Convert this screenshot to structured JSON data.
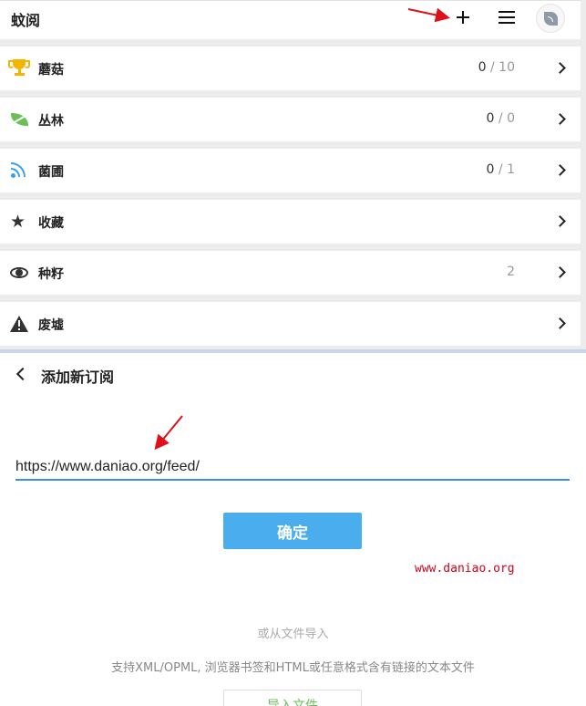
{
  "app": {
    "title": "蚊阅"
  },
  "header_icons": {
    "add": "plus-icon",
    "menu": "menu-icon",
    "avatar": "rss-leaf-icon"
  },
  "menu": [
    {
      "id": "mushroom",
      "label": "蘑菇",
      "icon": "trophy-icon",
      "icon_color": "#f5b400",
      "count": "0",
      "total": "/ 10"
    },
    {
      "id": "jungle",
      "label": "丛林",
      "icon": "leaf-icon",
      "icon_color": "#6bbf59",
      "count": "0",
      "total": "/ 0"
    },
    {
      "id": "nursery",
      "label": "菌圃",
      "icon": "rss-icon",
      "icon_color": "#3aa0e8",
      "count": "0",
      "total": "/ 1"
    },
    {
      "id": "favorites",
      "label": "收藏",
      "icon": "star-icon",
      "icon_color": "#333333",
      "count": "",
      "total": ""
    },
    {
      "id": "seeds",
      "label": "种籽",
      "icon": "eye-icon",
      "icon_color": "#333333",
      "count": "2",
      "total": ""
    },
    {
      "id": "ruins",
      "label": "废墟",
      "icon": "warning-icon",
      "icon_color": "#333333",
      "count": "",
      "total": ""
    }
  ],
  "add_feed": {
    "title": "添加新订阅",
    "url_value": "https://www.daniao.org/feed/",
    "confirm_label": "确定",
    "watermark": "www.daniao.org",
    "or_import": "或从文件导入",
    "support_text": "支持XML/OPML, 浏览器书签和HTML或任意格式含有链接的文本文件",
    "import_label": "导入文件"
  },
  "colors": {
    "accent_blue": "#4aaeee",
    "input_underline": "#3a8ee6",
    "annotation_red": "#e0101a",
    "import_green": "#6bbf59"
  }
}
